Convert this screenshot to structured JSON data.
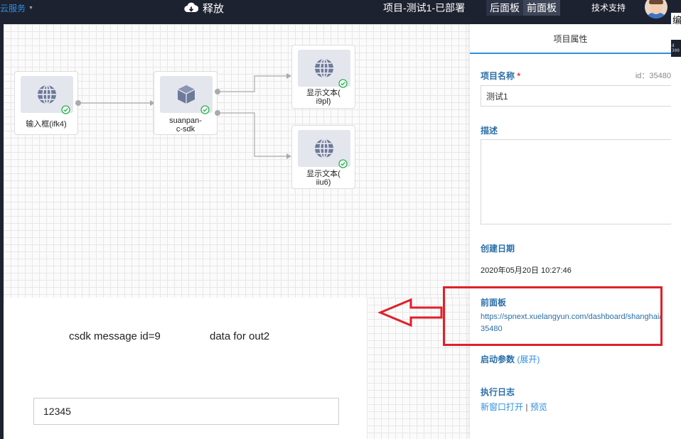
{
  "topbar": {
    "cloud_service": "云服务",
    "release": "释放",
    "project_title": "项目-测试1-已部署",
    "tabs": [
      {
        "label": "后面板",
        "active": false
      },
      {
        "label": "前面板",
        "active": true
      }
    ],
    "support": "技术支持",
    "edge_char": "编",
    "edge_mini": "d\n300"
  },
  "canvas": {
    "nodes": [
      {
        "icon": "globe-icon",
        "label": "输入框(ifk4)",
        "status": "ok"
      },
      {
        "icon": "cube-icon",
        "label_line1": "suanpan-",
        "label_line2": "c-sdk",
        "status": "ok"
      },
      {
        "icon": "globe-icon",
        "label_line1": "显示文本(",
        "label_line2": "i9pl)",
        "status": "ok"
      },
      {
        "icon": "globe-icon",
        "label_line1": "显示文本(",
        "label_line2": "iiu6)",
        "status": "ok"
      }
    ]
  },
  "form": {
    "message_left": "csdk message id=9",
    "message_right": "data for out2",
    "input_value": "12345"
  },
  "props": {
    "header": "项目属性",
    "name_label": "项目名称",
    "required_mark": "*",
    "id_text": "id：35480",
    "name_value": "测试1",
    "desc_label": "描述",
    "created_label": "创建日期",
    "created_value": "2020年05月20日 10:27:46",
    "front_label": "前面板",
    "front_url": "https://spnext.xuelangyun.com/dashboard/shanghai/35480",
    "startup_label": "启动参数",
    "startup_expand": "(展开)",
    "log_label": "执行日志",
    "log_new_window": "新窗口打开",
    "log_sep": "|",
    "log_preview": "预览"
  },
  "colors": {
    "accent": "#2f8fe0",
    "label_blue": "#2a6fa8",
    "highlight": "#e0202a",
    "topbar": "#1d2230"
  }
}
